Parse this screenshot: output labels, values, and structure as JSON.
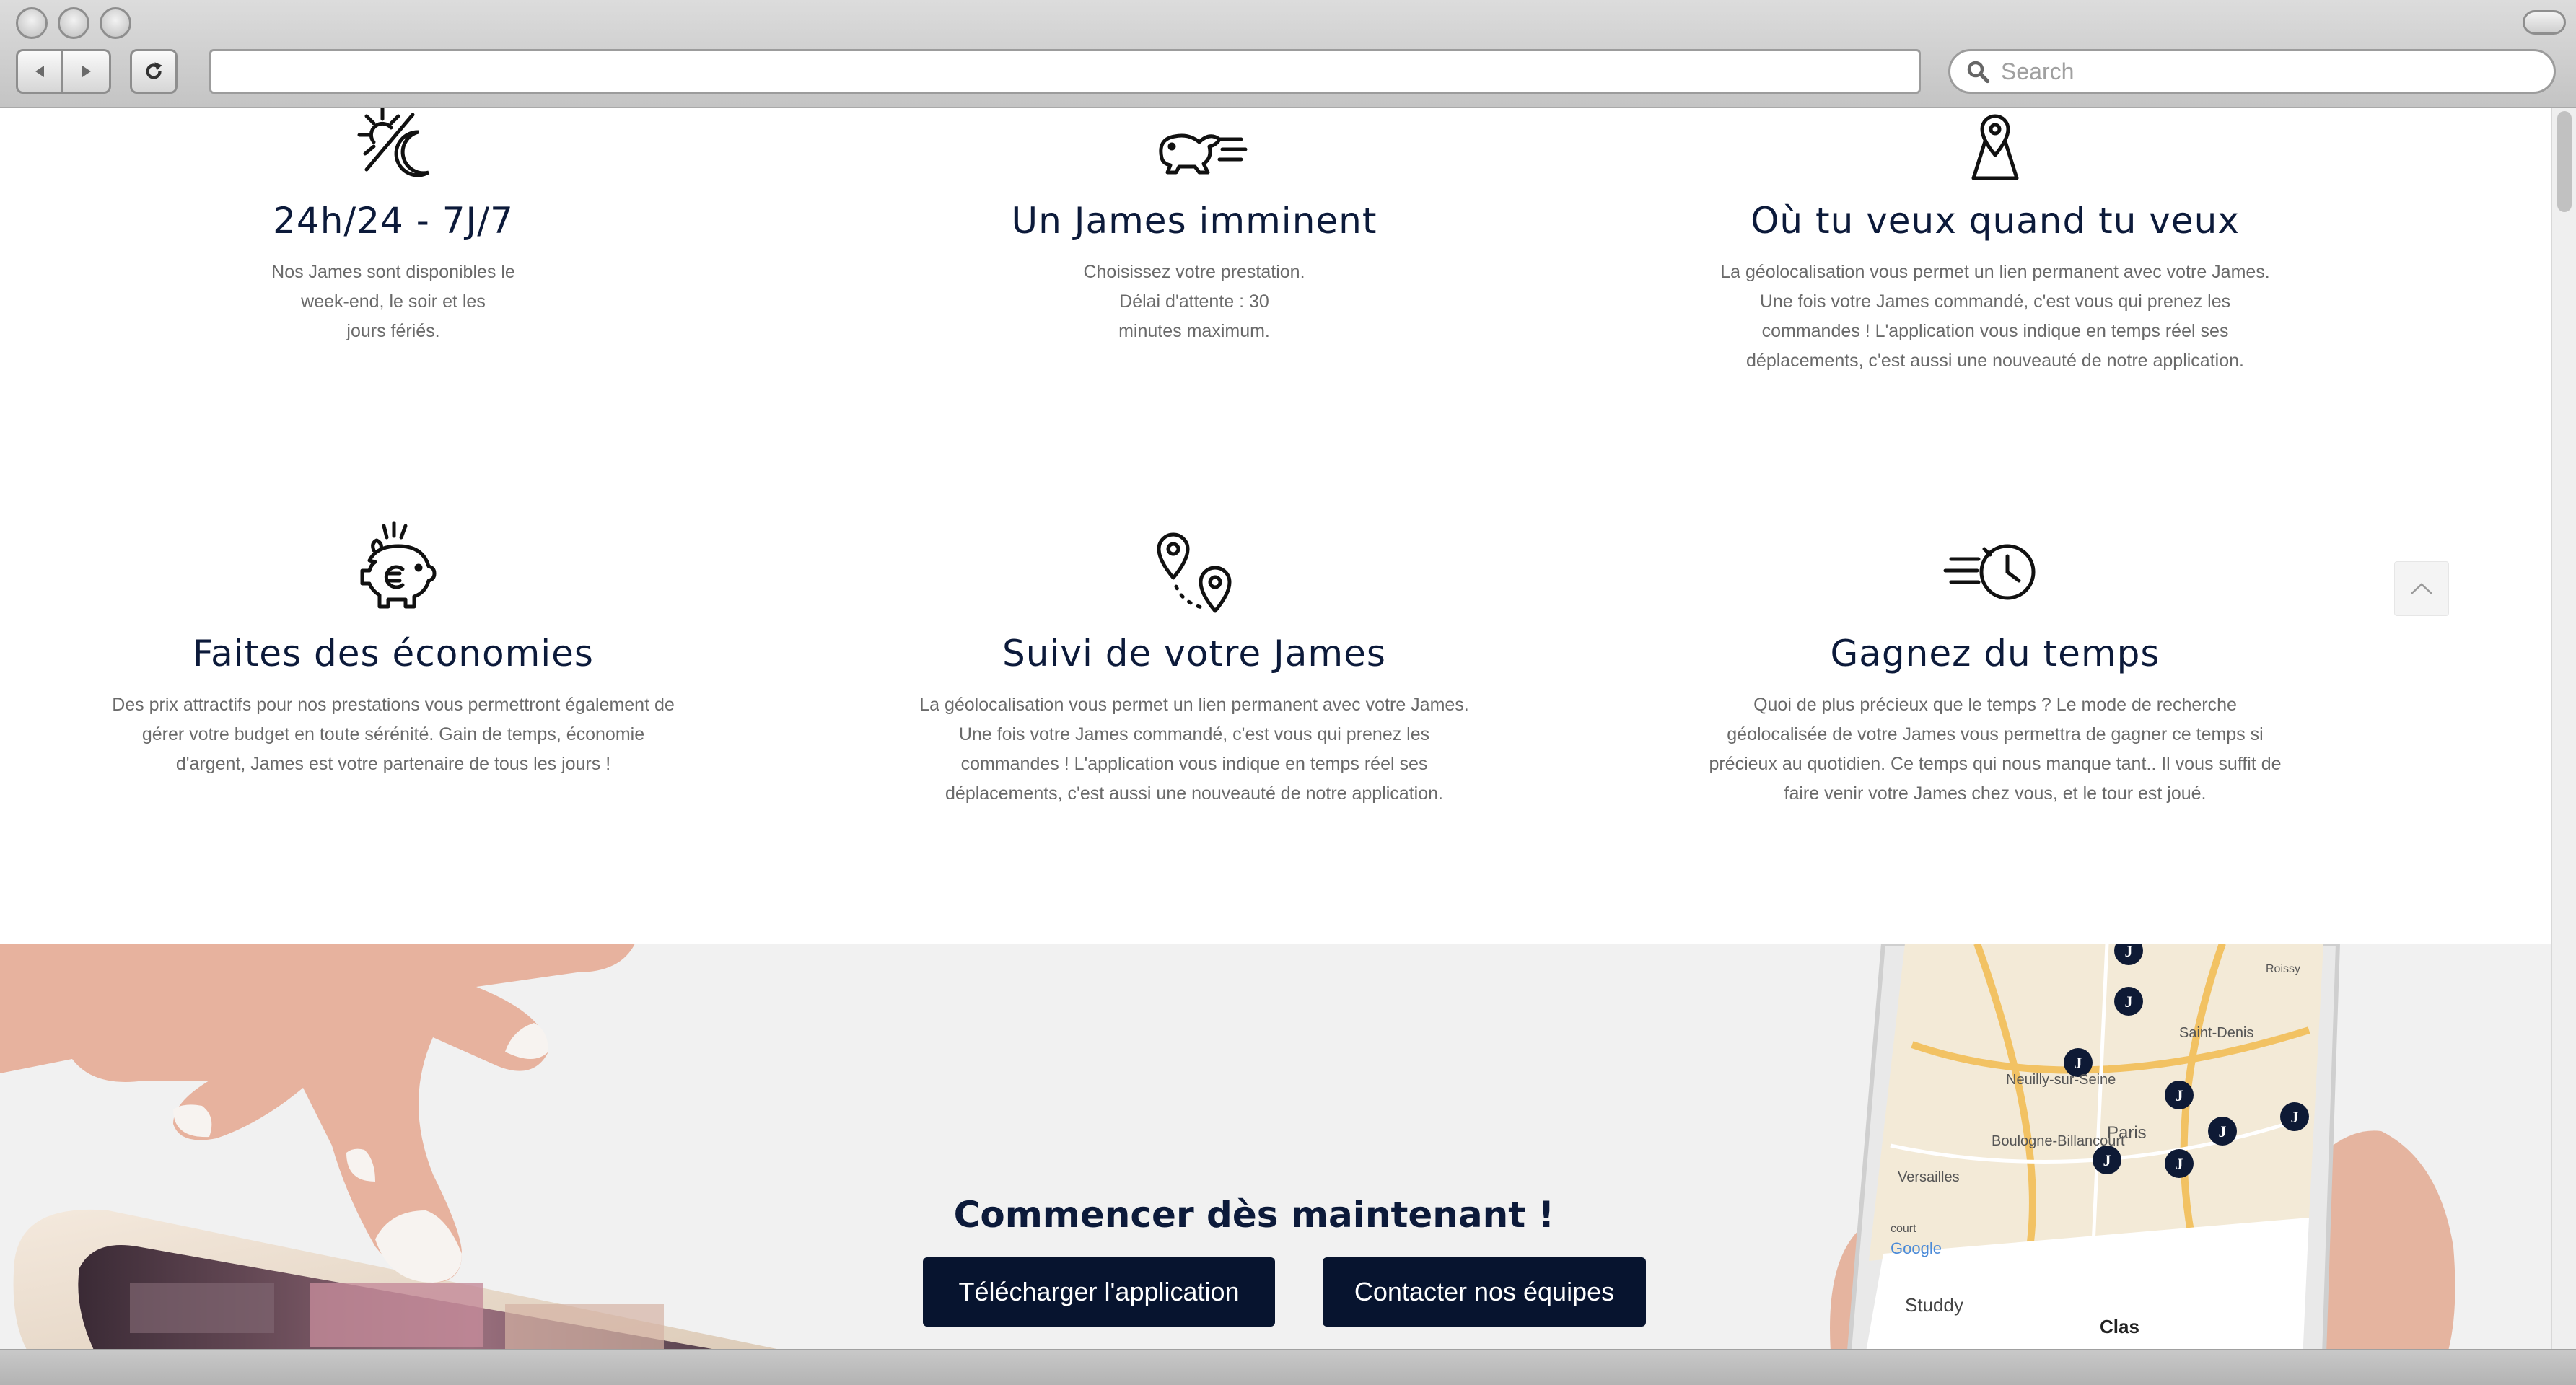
{
  "browser": {
    "search_placeholder": "Search",
    "url": ""
  },
  "features": [
    {
      "icon": "sun-moon-icon",
      "title": "24h/24 - 7J/7",
      "text": "Nos James sont disponibles le\nweek-end, le soir et les\njours fériés."
    },
    {
      "icon": "fast-rabbit-icon",
      "title": "Un James imminent",
      "text": "Choisissez votre prestation.\nDélai d'attente : 30\nminutes maximum."
    },
    {
      "icon": "map-pin-icon",
      "title": "Où tu veux quand tu veux",
      "text": "La géolocalisation vous permet un lien permanent avec votre James.\nUne fois votre James commandé,  c'est vous qui prenez les\ncommandes ! L'application vous indique en temps réel ses\ndéplacements, c'est aussi une nouveauté de notre application."
    },
    {
      "icon": "euro-piggy-bank-icon",
      "title": "Faites des économies",
      "text": "Des prix attractifs pour nos prestations vous permettront également de\ngérer votre budget en toute sérénité. Gain de temps, économie\nd'argent,  James est votre partenaire de tous les jours !"
    },
    {
      "icon": "route-pins-icon",
      "title": "Suivi de votre James",
      "text": "La géolocalisation vous permet un lien permanent avec votre James.\nUne fois votre James commandé,  c'est vous qui prenez les\ncommandes ! L'application vous indique en temps réel ses\ndéplacements, c'est aussi une nouveauté de notre application."
    },
    {
      "icon": "fast-clock-icon",
      "title": "Gagnez du temps",
      "text": "Quoi de plus précieux que le temps ? Le mode de recherche\ngéolocalisée de votre James vous permettra de gagner ce temps si\nprécieux au quotidien. Ce temps qui nous manque tant.. Il vous suffit de\nfaire venir votre James chez vous, et le tour est joué."
    }
  ],
  "cta": {
    "title": "Commencer dès maintenant !",
    "download_label": "Télécharger l'application",
    "contact_label": "Contacter nos équipes"
  },
  "map": {
    "labels": [
      "Saint-Denis",
      "Neuilly-sur-Seine",
      "Paris",
      "Boulogne-Billancourt",
      "Versailles",
      "Roissy",
      "Google",
      "Studdy",
      "Clas",
      "court"
    ],
    "marker_label": "J"
  },
  "colors": {
    "heading": "#0c1a3a",
    "button": "#07142f",
    "body_text": "#6a6a6a",
    "band": "#f1f1f1"
  }
}
